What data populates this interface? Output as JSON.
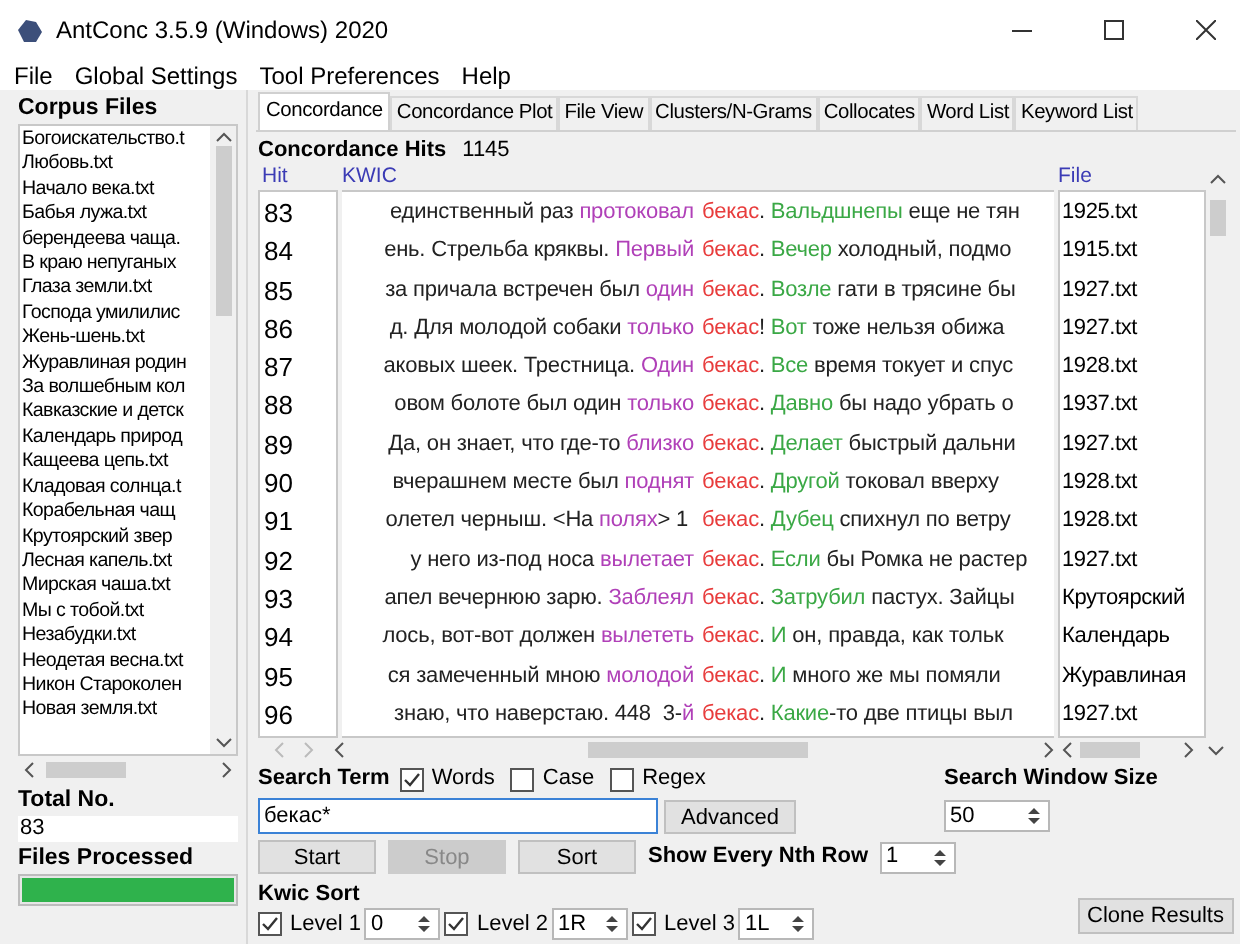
{
  "window": {
    "title": "AntConc 3.5.9 (Windows) 2020"
  },
  "menu": [
    "File",
    "Global Settings",
    "Tool Preferences",
    "Help"
  ],
  "corpus": {
    "label": "Corpus Files",
    "files": [
      "Богоискательство.t",
      "Любовь.txt",
      "Начало века.txt",
      "Бабья лужа.txt",
      "берендеева чаща.",
      "В краю непуганых",
      "Глаза земли.txt",
      "Господа умилилис",
      "Жень-шень.txt",
      "Журавлиная родин",
      "За волшебным кол",
      "Кавказские и детск",
      "Календарь природ",
      "Кащеева цепь.txt",
      "Кладовая солнца.t",
      "Корабельная чащ",
      "Крутоярский звер",
      "Лесная капель.txt",
      "Мирская чаша.txt",
      "Мы с тобой.txt",
      "Незабудки.txt",
      "Неодетая весна.txt",
      "Никон Староколен",
      "Новая земля.txt"
    ],
    "total_label": "Total No.",
    "total": "83",
    "processed_label": "Files Processed",
    "level": 1
  },
  "tabs": [
    {
      "label": "Concordance",
      "selected": true
    },
    {
      "label": "Concordance Plot",
      "selected": false
    },
    {
      "label": "File View",
      "selected": false
    },
    {
      "label": "Clusters/N-Grams",
      "selected": false
    },
    {
      "label": "Collocates",
      "selected": false
    },
    {
      "label": "Word List",
      "selected": false
    },
    {
      "label": "Keyword List",
      "selected": false
    }
  ],
  "hits": {
    "label": "Concordance Hits",
    "count": "1145"
  },
  "table": {
    "columns": [
      "Hit",
      "KWIC",
      "File"
    ],
    "rows": [
      {
        "hit": "83",
        "segments": [
          {
            "kind": "plain",
            "text": "единственный раз "
          },
          {
            "kind": "left",
            "text": "протоковал"
          },
          {
            "kind": "key",
            "text": "бекас"
          },
          {
            "kind": "plain",
            "text": ". "
          },
          {
            "kind": "right",
            "text": "Вальдшнепы"
          },
          {
            "kind": "plain",
            "text": " еще не тян"
          }
        ],
        "file": "1925.txt"
      },
      {
        "hit": "84",
        "segments": [
          {
            "kind": "plain",
            "text": "ень. Стрельба кряквы. "
          },
          {
            "kind": "left",
            "text": "Первый"
          },
          {
            "kind": "key",
            "text": "бекас"
          },
          {
            "kind": "plain",
            "text": ". "
          },
          {
            "kind": "right",
            "text": "Вечер"
          },
          {
            "kind": "plain",
            "text": " холодный, подмо"
          }
        ],
        "file": "1915.txt"
      },
      {
        "hit": "85",
        "segments": [
          {
            "kind": "plain",
            "text": "за причала встречен был "
          },
          {
            "kind": "left",
            "text": "один"
          },
          {
            "kind": "key",
            "text": "бекас"
          },
          {
            "kind": "plain",
            "text": ". "
          },
          {
            "kind": "right",
            "text": "Возле"
          },
          {
            "kind": "plain",
            "text": " гати в трясине бы"
          }
        ],
        "file": "1927.txt"
      },
      {
        "hit": "86",
        "segments": [
          {
            "kind": "plain",
            "text": "д. Для молодой собаки "
          },
          {
            "kind": "left",
            "text": "только"
          },
          {
            "kind": "key",
            "text": "бекас"
          },
          {
            "kind": "plain",
            "text": "! "
          },
          {
            "kind": "right",
            "text": "Вот"
          },
          {
            "kind": "plain",
            "text": " тоже нельзя обижа"
          }
        ],
        "file": "1927.txt"
      },
      {
        "hit": "87",
        "segments": [
          {
            "kind": "plain",
            "text": "аковых шеек. Трестница. "
          },
          {
            "kind": "left",
            "text": "Один"
          },
          {
            "kind": "key",
            "text": "бекас"
          },
          {
            "kind": "plain",
            "text": ". "
          },
          {
            "kind": "right",
            "text": "Все"
          },
          {
            "kind": "plain",
            "text": " время токует и спус"
          }
        ],
        "file": "1928.txt"
      },
      {
        "hit": "88",
        "segments": [
          {
            "kind": "plain",
            "text": "овом болоте был один "
          },
          {
            "kind": "left",
            "text": "только"
          },
          {
            "kind": "key",
            "text": "бекас"
          },
          {
            "kind": "plain",
            "text": ". "
          },
          {
            "kind": "right",
            "text": "Давно"
          },
          {
            "kind": "plain",
            "text": " бы надо убрать о"
          }
        ],
        "file": "1937.txt"
      },
      {
        "hit": "89",
        "segments": [
          {
            "kind": "plain",
            "text": "Да, он знает, что где-то "
          },
          {
            "kind": "left",
            "text": "близко"
          },
          {
            "kind": "key",
            "text": "бекас"
          },
          {
            "kind": "plain",
            "text": ". "
          },
          {
            "kind": "right",
            "text": "Делает"
          },
          {
            "kind": "plain",
            "text": " быстрый дальни"
          }
        ],
        "file": "1927.txt"
      },
      {
        "hit": "90",
        "segments": [
          {
            "kind": "plain",
            "text": "вчерашнем месте был "
          },
          {
            "kind": "left",
            "text": "поднят"
          },
          {
            "kind": "key",
            "text": "бекас"
          },
          {
            "kind": "plain",
            "text": ". "
          },
          {
            "kind": "right",
            "text": "Другой"
          },
          {
            "kind": "plain",
            "text": " токовал вверху"
          }
        ],
        "file": "1928.txt"
      },
      {
        "hit": "91",
        "segments": [
          {
            "kind": "plain",
            "text": "олетел черныш. <На "
          },
          {
            "kind": "left",
            "text": "полях"
          },
          {
            "kind": "plain",
            "text": "> 1 "
          },
          {
            "kind": "key",
            "text": "бекас"
          },
          {
            "kind": "plain",
            "text": ". "
          },
          {
            "kind": "right",
            "text": "Дубец"
          },
          {
            "kind": "plain",
            "text": " спихнул по ветру"
          }
        ],
        "file": "1928.txt"
      },
      {
        "hit": "92",
        "segments": [
          {
            "kind": "plain",
            "text": "у него из-под носа "
          },
          {
            "kind": "left",
            "text": "вылетает"
          },
          {
            "kind": "key",
            "text": "бекас"
          },
          {
            "kind": "plain",
            "text": ". "
          },
          {
            "kind": "right",
            "text": "Если"
          },
          {
            "kind": "plain",
            "text": " бы Ромка не растер"
          }
        ],
        "file": "1927.txt"
      },
      {
        "hit": "93",
        "segments": [
          {
            "kind": "plain",
            "text": "апел вечернюю зарю. "
          },
          {
            "kind": "left",
            "text": "Заблеял"
          },
          {
            "kind": "key",
            "text": "бекас"
          },
          {
            "kind": "plain",
            "text": ". "
          },
          {
            "kind": "right",
            "text": "Затрубил"
          },
          {
            "kind": "plain",
            "text": " пастух. Зайцы"
          }
        ],
        "file": "Крутоярский"
      },
      {
        "hit": "94",
        "segments": [
          {
            "kind": "plain",
            "text": "лось, вот-вот должен "
          },
          {
            "kind": "left",
            "text": "вылететь"
          },
          {
            "kind": "key",
            "text": "бекас"
          },
          {
            "kind": "plain",
            "text": ". "
          },
          {
            "kind": "right",
            "text": "И"
          },
          {
            "kind": "plain",
            "text": " он, правда, как тольк"
          }
        ],
        "file": "Календарь"
      },
      {
        "hit": "95",
        "segments": [
          {
            "kind": "plain",
            "text": "ся замеченный мною "
          },
          {
            "kind": "left",
            "text": "молодой"
          },
          {
            "kind": "key",
            "text": "бекас"
          },
          {
            "kind": "plain",
            "text": ". "
          },
          {
            "kind": "right",
            "text": "И"
          },
          {
            "kind": "plain",
            "text": " много же мы помяли"
          }
        ],
        "file": "Журавлиная"
      },
      {
        "hit": "96",
        "segments": [
          {
            "kind": "plain",
            "text": "знаю, что наверстаю. 448  3-"
          },
          {
            "kind": "left",
            "text": "й"
          },
          {
            "kind": "key",
            "text": "бекас"
          },
          {
            "kind": "plain",
            "text": ". "
          },
          {
            "kind": "right",
            "text": "Какие"
          },
          {
            "kind": "plain",
            "text": "-то две птицы выл"
          }
        ],
        "file": "1927.txt"
      }
    ]
  },
  "search": {
    "label": "Search Term",
    "options": [
      {
        "label": "Words",
        "checked": true
      },
      {
        "label": "Case",
        "checked": false
      },
      {
        "label": "Regex",
        "checked": false
      }
    ],
    "value": "бекас*",
    "advanced": "Advanced",
    "window_label": "Search Window Size",
    "window_size": "50"
  },
  "actions": [
    {
      "label": "Start",
      "disabled": false
    },
    {
      "label": "Stop",
      "disabled": true
    },
    {
      "label": "Sort",
      "disabled": false
    }
  ],
  "nth": {
    "label": "Show Every Nth Row",
    "value": "1"
  },
  "kwic_sort": {
    "label": "Kwic Sort",
    "levels": [
      {
        "label": "Level 1",
        "checked": true,
        "value": "0"
      },
      {
        "label": "Level 2",
        "checked": true,
        "value": "1R"
      },
      {
        "label": "Level 3",
        "checked": true,
        "value": "1L"
      }
    ]
  },
  "clone": "Clone Results"
}
